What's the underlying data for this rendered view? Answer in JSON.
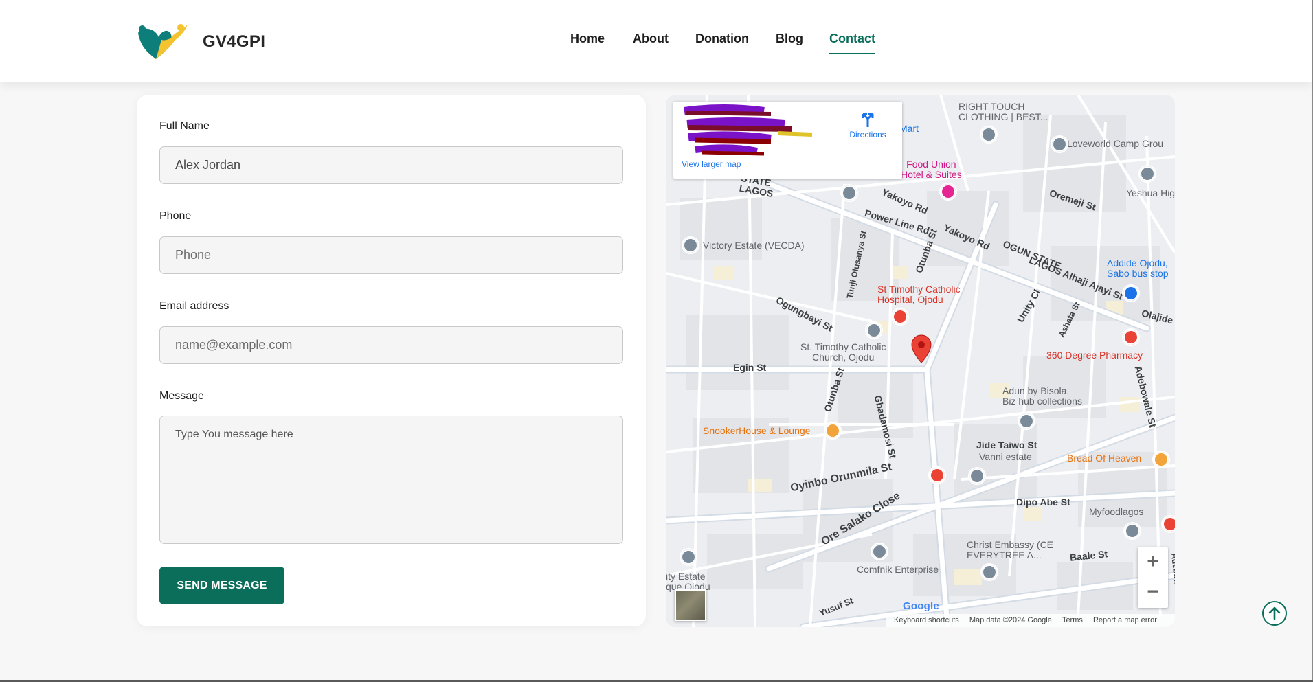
{
  "header": {
    "brand": "GV4GPI",
    "nav": [
      {
        "label": "Home",
        "active": false
      },
      {
        "label": "About",
        "active": false
      },
      {
        "label": "Donation",
        "active": false
      },
      {
        "label": "Blog",
        "active": false
      },
      {
        "label": "Contact",
        "active": true
      }
    ]
  },
  "form": {
    "full_name": {
      "label": "Full Name",
      "value": "Alex Jordan",
      "placeholder": "Full Name"
    },
    "phone": {
      "label": "Phone",
      "value": "",
      "placeholder": "Phone"
    },
    "email": {
      "label": "Email address",
      "value": "",
      "placeholder": "name@example.com"
    },
    "message": {
      "label": "Message",
      "value": "",
      "placeholder": "Type You message here"
    },
    "submit_label": "SEND MESSAGE"
  },
  "map": {
    "info_card": {
      "directions": "Directions",
      "larger_map": "View larger map"
    },
    "places": {
      "right_touch": "RIGHT TOUCH\nCLOTHING | BEST...",
      "loveworld": "Loveworld Camp Grou",
      "yeshua": "Yeshua Hig",
      "mart": "Mart",
      "food_union": "Food Union\nHotel & Suites",
      "oremeji": "Oremeji St",
      "lagos_state": "STATE\nLAGOS",
      "yakoyo_rd_1": "Yakoyo Rd",
      "power_line": "Power Line Rd",
      "yakoyo_rd_2": "Yakoyo Rd",
      "ogun_state": "OGUN STATE",
      "lagos_alhaji": "LAGOS Alhaji Ajayi St",
      "addide": "Addide Ojodu,\nSabo bus stop",
      "victory_estate": "Victory Estate (VECDA)",
      "otunba_st_1": "Otunba St",
      "tunji_olusanya": "Tunji Olusanya St",
      "st_timothy_hospital": "St Timothy Catholic\nHospital, Ojodu",
      "unity_cl": "Unity Cl",
      "ashafa": "Ashafa St",
      "olajide": "Olajide",
      "ogungbayi": "Ogungbayi St",
      "st_timothy_church": "St. Timothy Catholic\nChurch, Ojodu",
      "pharmacy": "360 Degree Pharmacy",
      "egin": "Egin St",
      "adebowale": "Adebowale St",
      "otunba_st_2": "Otunba St",
      "gbadamosi": "Gbadamosi St",
      "adun": "Adun by Bisola.\nBiz hub collections",
      "snooker": "SnookerHouse & Lounge",
      "jide_taiwo": "Jide Taiwo St",
      "vanni": "Vanni estate",
      "bread_of_heaven": "Bread Of Heaven",
      "oyinbo": "Oyinbo Orunmila St",
      "dipo_abe": "Dipo Abe St",
      "ore_salako": "Ore Salako Close",
      "myfoodlagos": "Myfoodlagos",
      "christ_embassy": "Christ Embassy (CE\nEVERYTREE A...",
      "comfnik": "Comfnik Enterprise",
      "baale": "Baale St",
      "ity_estate": "ity Estate\nque Ojodu",
      "yusuf": "Yusuf St",
      "adebowale_2": "Adebowal"
    },
    "google": "Google",
    "attribution": {
      "shortcuts": "Keyboard shortcuts",
      "data": "Map data ©2024 Google",
      "terms": "Terms",
      "report": "Report a map error"
    },
    "zoom_in": "+",
    "zoom_out": "−"
  },
  "colors": {
    "accent": "#0a6e5a",
    "map_pin": "#ea4335"
  },
  "icons": [
    "logo-icon",
    "directions-icon",
    "map-pin-icon",
    "arrow-up-icon"
  ]
}
